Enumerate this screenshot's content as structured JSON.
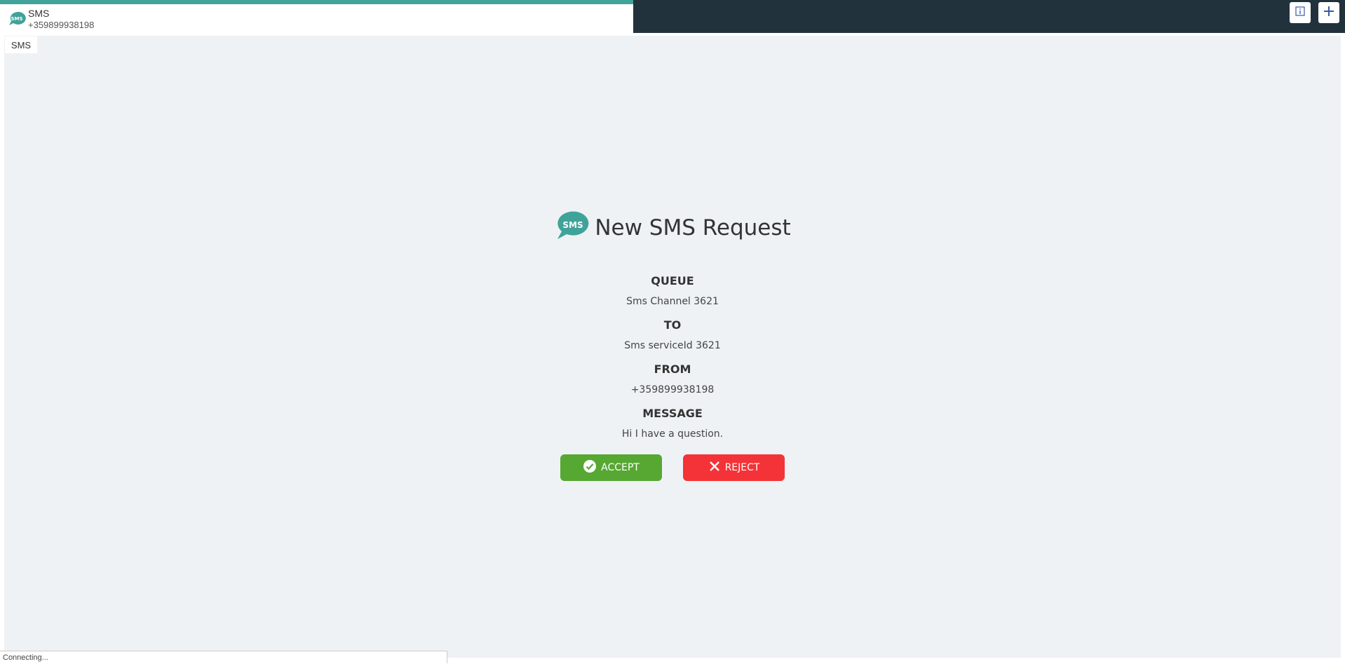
{
  "tab": {
    "icon": "sms-bubble-icon",
    "title": "SMS",
    "subtitle": "+359899938198"
  },
  "toolbar": {
    "info_icon": "info-icon",
    "add_icon": "plus-icon"
  },
  "content_tab": {
    "label": "SMS"
  },
  "request": {
    "icon": "sms-bubble-icon",
    "title": "New SMS Request",
    "fields": [
      {
        "label": "QUEUE",
        "value": "Sms Channel 3621"
      },
      {
        "label": "TO",
        "value": "Sms serviceId 3621"
      },
      {
        "label": "FROM",
        "value": "+359899938198"
      },
      {
        "label": "MESSAGE",
        "value": "Hi I have a question."
      }
    ],
    "accept_label": "ACCEPT",
    "reject_label": "REJECT"
  },
  "status": {
    "text": "Connecting..."
  },
  "colors": {
    "accent": "#3fa39a",
    "topbar": "#21323c",
    "accept": "#56a832",
    "reject": "#f43338",
    "content_bg": "#eef2f5"
  }
}
